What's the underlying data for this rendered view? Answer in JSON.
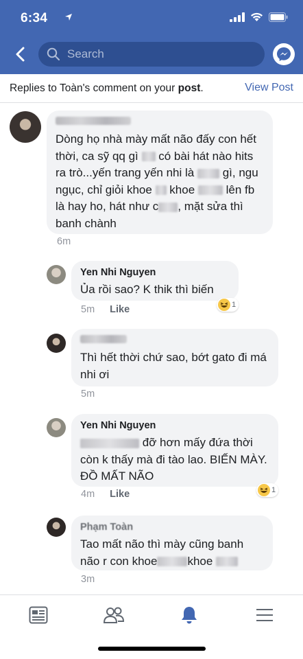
{
  "status_bar": {
    "time": "6:34"
  },
  "search": {
    "placeholder": "Search"
  },
  "subheader": {
    "prefix": "Replies to Toàn's comment on your ",
    "post_word": "post",
    "suffix": ".",
    "view_post": "View Post"
  },
  "comments": [
    {
      "author": "",
      "segments": [
        "Dòng họ nhà mày mất não đấy con hết thời, ca sỹ qq gì",
        "có bài hát nào hits ra trò...yến trang yến nhi là",
        "gì, ngu ngục, chỉ giỏi khoe",
        "khoe",
        "lên fb là hay ho, hát như c",
        ", mặt sửa thì banh chành"
      ],
      "time": "6m"
    },
    {
      "author": "Yen Nhi Nguyen",
      "text": "Ủa rồi sao? K thik thì biến",
      "time": "5m",
      "like": "Like",
      "reaction_count": "1"
    },
    {
      "author": "",
      "text": "Thì hết thời chứ sao, bớt gato đi má nhi ơi",
      "time": "5m"
    },
    {
      "author": "Yen Nhi Nguyen",
      "segments": [
        "đỡ hơn mấy đứa thời còn k thấy mà đi tào lao. BIẾN MÀY. ĐỒ MẤT NÃO"
      ],
      "time": "4m",
      "like": "Like",
      "reaction_count": "1"
    },
    {
      "author": "Phạm Toàn",
      "segments": [
        "Tao mất não thì mày cũng banh não r con khoe",
        "khoe"
      ],
      "time": "3m"
    }
  ],
  "colors": {
    "brand": "#4267b2",
    "bubble": "#f2f3f5",
    "meta": "#90949c"
  },
  "tabs": [
    "news-feed-icon",
    "friends-icon",
    "notifications-icon",
    "menu-icon"
  ]
}
